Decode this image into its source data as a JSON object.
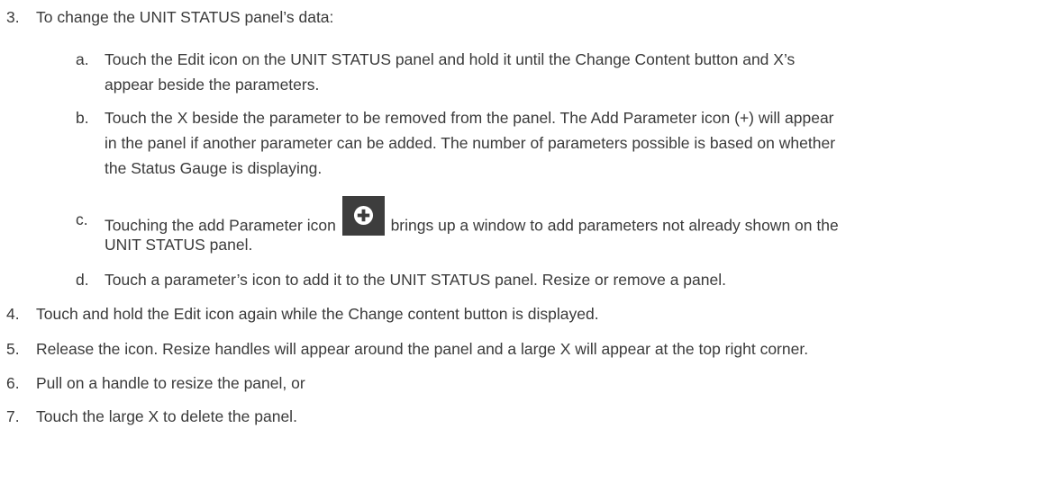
{
  "steps": [
    {
      "num": "3.",
      "text": "To change the UNIT STATUS panel’s data:",
      "substeps": [
        {
          "letter": "a.",
          "line1": "Touch the Edit icon on the UNIT STATUS panel and hold it until the Change Content button and X’s",
          "line2": "appear beside the parameters."
        },
        {
          "letter": "b.",
          "line1": "Touch the X beside the parameter to be removed from the panel. The Add Parameter icon (+) will appear",
          "line2": "in the panel if another parameter can be added. The number of parameters possible is based on whether",
          "line3": "the Status Gauge is displaying."
        },
        {
          "letter": "c.",
          "before_icon": "Touching the add Parameter icon",
          "after_icon": "brings up a window to add parameters not already shown on the",
          "line2": "UNIT STATUS panel.",
          "icon": "add-parameter-plus-icon"
        },
        {
          "letter": "d.",
          "line1": "Touch a parameter’s icon to add it to the UNIT STATUS panel. Resize or remove a panel."
        }
      ]
    },
    {
      "num": "4.",
      "text": "Touch and hold the Edit icon again while the Change content button is displayed."
    },
    {
      "num": "5.",
      "text": "Release the icon. Resize handles will appear around the panel and a large X will appear at the top right corner."
    },
    {
      "num": "6.",
      "text": "Pull on a handle to resize the panel, or"
    },
    {
      "num": "7.",
      "text": "Touch the large X to delete the panel."
    }
  ]
}
